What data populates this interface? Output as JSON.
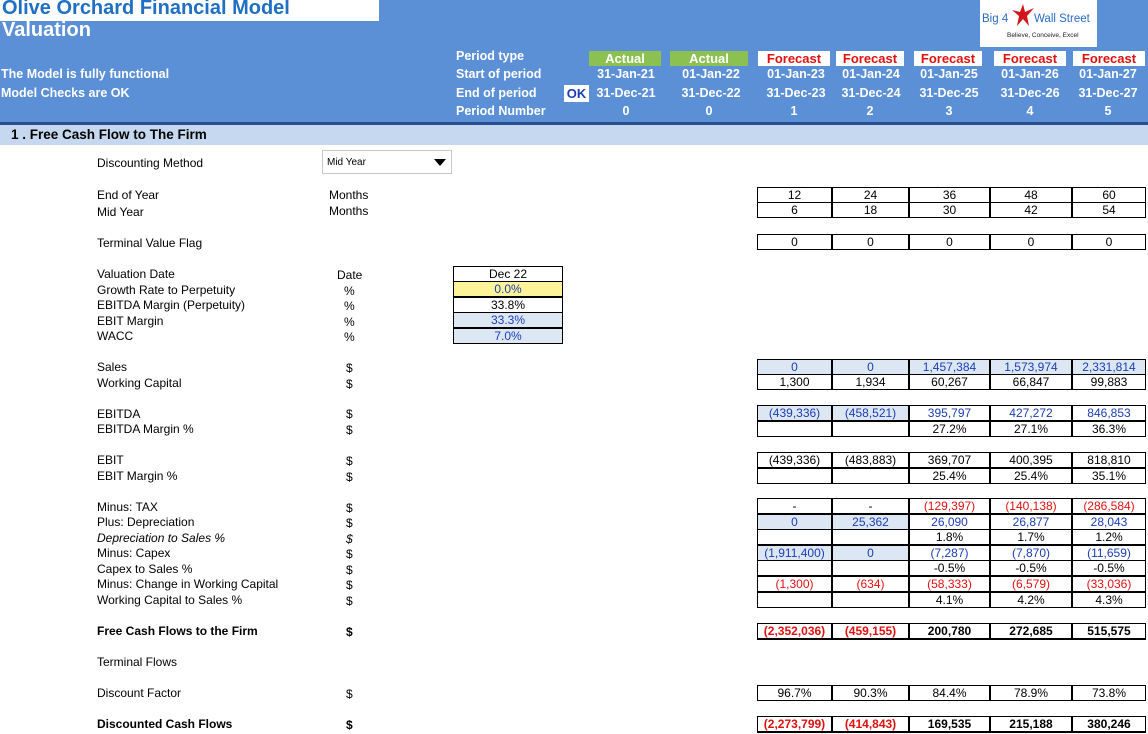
{
  "header": {
    "title": "Olive Orchard Financial Model",
    "subtitle": "Valuation",
    "status_model": "The Model is fully functional",
    "status_checks": "Model Checks are OK",
    "ok_badge": "OK",
    "logo": {
      "left": "Big 4",
      "right": "Wall Street",
      "tagline": "Believe, Conceive, Excel"
    },
    "period_labels": {
      "type": "Period type",
      "start": "Start of period",
      "end": "End of period",
      "number": "Period Number"
    },
    "periods": [
      {
        "type": "Actual",
        "start": "31-Jan-21",
        "end": "31-Dec-21",
        "number": "0"
      },
      {
        "type": "Actual",
        "start": "01-Jan-22",
        "end": "31-Dec-22",
        "number": "0"
      },
      {
        "type": "Forecast",
        "start": "01-Jan-23",
        "end": "31-Dec-23",
        "number": "1"
      },
      {
        "type": "Forecast",
        "start": "01-Jan-24",
        "end": "31-Dec-24",
        "number": "2"
      },
      {
        "type": "Forecast",
        "start": "01-Jan-25",
        "end": "31-Dec-25",
        "number": "3"
      },
      {
        "type": "Forecast",
        "start": "01-Jan-26",
        "end": "31-Dec-26",
        "number": "4"
      },
      {
        "type": "Forecast",
        "start": "01-Jan-27",
        "end": "31-Dec-27",
        "number": "5"
      }
    ]
  },
  "section_title": "1 . Free Cash Flow to The Firm",
  "discounting": {
    "label": "Discounting Method",
    "value": "Mid Year"
  },
  "inputs": {
    "valuation_date": {
      "label": "Valuation Date",
      "unit": "Date",
      "value": "Dec 22"
    },
    "growth_rate": {
      "label": "Growth Rate to Perpetuity",
      "unit": "%",
      "value": "0.0%"
    },
    "ebitda_margin": {
      "label": "EBITDA Margin (Perpetuity)",
      "unit": "%",
      "value": "33.8%"
    },
    "ebit_margin": {
      "label": "EBIT Margin",
      "unit": "%",
      "value": "33.3%"
    },
    "wacc": {
      "label": "WACC",
      "unit": "%",
      "value": "7.0%"
    }
  },
  "rows": {
    "end_of_year": {
      "label": "End of Year",
      "unit": "Months",
      "values": [
        "12",
        "24",
        "36",
        "48",
        "60"
      ]
    },
    "mid_year": {
      "label": "Mid Year",
      "unit": "Months",
      "values": [
        "6",
        "18",
        "30",
        "42",
        "54"
      ]
    },
    "terminal_flag": {
      "label": "Terminal Value Flag",
      "unit": "",
      "values": [
        "0",
        "0",
        "0",
        "0",
        "0"
      ]
    },
    "sales": {
      "label": "Sales",
      "unit": "$",
      "values": [
        "0",
        "0",
        "1,457,384",
        "1,573,974",
        "2,331,814"
      ]
    },
    "working_capital": {
      "label": "Working Capital",
      "unit": "$",
      "values": [
        "1,300",
        "1,934",
        "60,267",
        "66,847",
        "99,883"
      ]
    },
    "ebitda": {
      "label": "EBITDA",
      "unit": "$",
      "values": [
        "(439,336)",
        "(458,521)",
        "395,797",
        "427,272",
        "846,853"
      ]
    },
    "ebitda_margin": {
      "label": "EBITDA Margin %",
      "unit": "$",
      "values": [
        "",
        "",
        "27.2%",
        "27.1%",
        "36.3%"
      ]
    },
    "ebit": {
      "label": "EBIT",
      "unit": "$",
      "values": [
        "(439,336)",
        "(483,883)",
        "369,707",
        "400,395",
        "818,810"
      ]
    },
    "ebit_margin": {
      "label": "EBIT Margin %",
      "unit": "$",
      "values": [
        "",
        "",
        "25.4%",
        "25.4%",
        "35.1%"
      ]
    },
    "tax": {
      "label": "Minus: TAX",
      "unit": "$",
      "values": [
        "-",
        "-",
        "(129,397)",
        "(140,138)",
        "(286,584)"
      ]
    },
    "depreciation": {
      "label": "Plus: Depreciation",
      "unit": "$",
      "values": [
        "0",
        "25,362",
        "26,090",
        "26,877",
        "28,043"
      ]
    },
    "dep_to_sales": {
      "label": "Depreciation to Sales %",
      "unit": "$",
      "values": [
        "",
        "",
        "1.8%",
        "1.7%",
        "1.2%"
      ]
    },
    "capex": {
      "label": "Minus: Capex",
      "unit": "$",
      "values": [
        "(1,911,400)",
        "0",
        "(7,287)",
        "(7,870)",
        "(11,659)"
      ]
    },
    "capex_to_sales": {
      "label": "Capex to Sales %",
      "unit": "$",
      "values": [
        "",
        "",
        "-0.5%",
        "-0.5%",
        "-0.5%"
      ]
    },
    "change_wc": {
      "label": "Minus: Change in Working Capital",
      "unit": "$",
      "values": [
        "(1,300)",
        "(634)",
        "(58,333)",
        "(6,579)",
        "(33,036)"
      ]
    },
    "wc_to_sales": {
      "label": "Working Capital to Sales %",
      "unit": "$",
      "values": [
        "",
        "",
        "4.1%",
        "4.2%",
        "4.3%"
      ]
    },
    "fcff": {
      "label": "Free Cash Flows to the Firm",
      "unit": "$",
      "values": [
        "(2,352,036)",
        "(459,155)",
        "200,780",
        "272,685",
        "515,575"
      ]
    },
    "terminal_flows": {
      "label": "Terminal Flows",
      "unit": "",
      "values": []
    },
    "discount_factor": {
      "label": "Discount Factor",
      "unit": "$",
      "values": [
        "96.7%",
        "90.3%",
        "84.4%",
        "78.9%",
        "73.8%"
      ]
    },
    "discounted_cf": {
      "label": "Discounted Cash Flows",
      "unit": "$",
      "values": [
        "(2,273,799)",
        "(414,843)",
        "169,535",
        "215,188",
        "380,246"
      ]
    }
  },
  "colors": {
    "header_bg": "#5b8fd6",
    "actual_green": "#8cc051",
    "forecast_red": "#e01010",
    "input_blue": "#1a3db5",
    "section_bg": "#c5d8ef",
    "input_yellow": "#fdf49a"
  }
}
